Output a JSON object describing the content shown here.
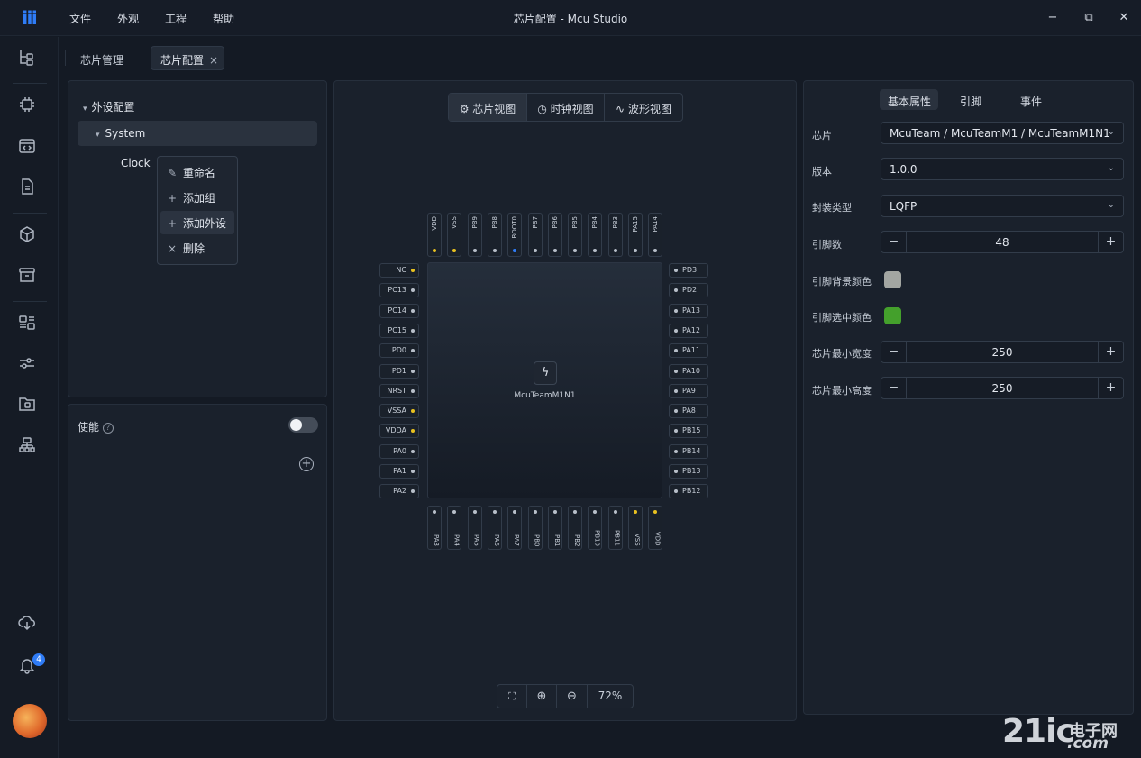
{
  "window": {
    "title": "芯片配置 - Mcu Studio",
    "logo": "ⅲ",
    "minimize": "−",
    "restore": "⧉",
    "close": "✕"
  },
  "menu": [
    "文件",
    "外观",
    "工程",
    "帮助"
  ],
  "activity_icons": [
    "flow-tree-icon",
    "cpu-icon",
    "code-window-icon",
    "document-icon",
    "cube-icon",
    "archive-icon",
    "layout-icon",
    "sliders-icon",
    "folder-icon",
    "hierarchy-icon",
    "cloud-download-icon",
    "bell-icon",
    "avatar"
  ],
  "notification_count": "4",
  "tabs": {
    "tab1": "芯片管理",
    "tab2": "芯片配置",
    "close": "×"
  },
  "tree": {
    "root": "外设配置",
    "system": "System",
    "clock": "Clock",
    "arrow_down": "▾"
  },
  "context_menu": [
    {
      "icon": "✎",
      "label": "重命名"
    },
    {
      "icon": "+",
      "label": "添加组"
    },
    {
      "icon": "+",
      "label": "添加外设"
    },
    {
      "icon": "×",
      "label": "删除"
    }
  ],
  "enable": {
    "label": "使能",
    "help": "?",
    "enabled": false,
    "add": "+"
  },
  "view_tabs": [
    {
      "icon": "⚙",
      "label": "芯片视图"
    },
    {
      "icon": "◷",
      "label": "时钟视图"
    },
    {
      "icon": "∿",
      "label": "波形视图"
    }
  ],
  "chip": {
    "name": "McuTeamM1N1",
    "icon": "ϟ",
    "pins_top": [
      {
        "n": "VDD",
        "c": "#e8c020"
      },
      {
        "n": "VSS",
        "c": "#e8c020"
      },
      {
        "n": "PB9",
        "c": "#b8bfc9"
      },
      {
        "n": "PB8",
        "c": "#b8bfc9"
      },
      {
        "n": "BOOT0",
        "c": "#2f7cf6"
      },
      {
        "n": "PB7",
        "c": "#b8bfc9"
      },
      {
        "n": "PB6",
        "c": "#b8bfc9"
      },
      {
        "n": "PB5",
        "c": "#b8bfc9"
      },
      {
        "n": "PB4",
        "c": "#b8bfc9"
      },
      {
        "n": "PB3",
        "c": "#b8bfc9"
      },
      {
        "n": "PA15",
        "c": "#b8bfc9"
      },
      {
        "n": "PA14",
        "c": "#b8bfc9"
      }
    ],
    "pins_left": [
      {
        "n": "NC",
        "c": "#e8c020"
      },
      {
        "n": "PC13",
        "c": "#b8bfc9"
      },
      {
        "n": "PC14",
        "c": "#b8bfc9"
      },
      {
        "n": "PC15",
        "c": "#b8bfc9"
      },
      {
        "n": "PD0",
        "c": "#b8bfc9"
      },
      {
        "n": "PD1",
        "c": "#b8bfc9"
      },
      {
        "n": "NRST",
        "c": "#b8bfc9"
      },
      {
        "n": "VSSA",
        "c": "#e8c020"
      },
      {
        "n": "VDDA",
        "c": "#e8c020"
      },
      {
        "n": "PA0",
        "c": "#b8bfc9"
      },
      {
        "n": "PA1",
        "c": "#b8bfc9"
      },
      {
        "n": "PA2",
        "c": "#b8bfc9"
      }
    ],
    "pins_right": [
      {
        "n": "PD3",
        "c": "#b8bfc9"
      },
      {
        "n": "PD2",
        "c": "#b8bfc9"
      },
      {
        "n": "PA13",
        "c": "#b8bfc9"
      },
      {
        "n": "PA12",
        "c": "#b8bfc9"
      },
      {
        "n": "PA11",
        "c": "#b8bfc9"
      },
      {
        "n": "PA10",
        "c": "#b8bfc9"
      },
      {
        "n": "PA9",
        "c": "#b8bfc9"
      },
      {
        "n": "PA8",
        "c": "#b8bfc9"
      },
      {
        "n": "PB15",
        "c": "#b8bfc9"
      },
      {
        "n": "PB14",
        "c": "#b8bfc9"
      },
      {
        "n": "PB13",
        "c": "#b8bfc9"
      },
      {
        "n": "PB12",
        "c": "#b8bfc9"
      }
    ],
    "pins_bottom": [
      {
        "n": "PA3",
        "c": "#b8bfc9"
      },
      {
        "n": "PA4",
        "c": "#b8bfc9"
      },
      {
        "n": "PA5",
        "c": "#b8bfc9"
      },
      {
        "n": "PA6",
        "c": "#b8bfc9"
      },
      {
        "n": "PA7",
        "c": "#b8bfc9"
      },
      {
        "n": "PB0",
        "c": "#b8bfc9"
      },
      {
        "n": "PB1",
        "c": "#b8bfc9"
      },
      {
        "n": "PB2",
        "c": "#b8bfc9"
      },
      {
        "n": "PB10",
        "c": "#b8bfc9"
      },
      {
        "n": "PB11",
        "c": "#b8bfc9"
      },
      {
        "n": "VSS",
        "c": "#e8c020"
      },
      {
        "n": "VDD",
        "c": "#e8c020"
      }
    ]
  },
  "zoom": {
    "fit": "⛶",
    "zoom_in": "⊕",
    "zoom_out": "⊖",
    "level": "72%"
  },
  "props_tabs": [
    "基本属性",
    "引脚",
    "事件"
  ],
  "props": {
    "chip_label": "芯片",
    "chip_value": "McuTeam / McuTeamM1 / McuTeamM1N1",
    "version_label": "版本",
    "version_value": "1.0.0",
    "package_label": "封装类型",
    "package_value": "LQFP",
    "pins_label": "引脚数",
    "pins_value": "48",
    "pin_bg_label": "引脚背景颜色",
    "pin_bg_color": "#a3a6a2",
    "pin_sel_label": "引脚选中颜色",
    "pin_sel_color": "#44a02c",
    "min_w_label": "芯片最小宽度",
    "min_w_value": "250",
    "min_h_label": "芯片最小高度",
    "min_h_value": "250",
    "chevron": "⌄",
    "minus": "−",
    "plus": "+"
  },
  "watermark": {
    "big": "21ic",
    "top": "电子网",
    "bottom": ".com"
  }
}
